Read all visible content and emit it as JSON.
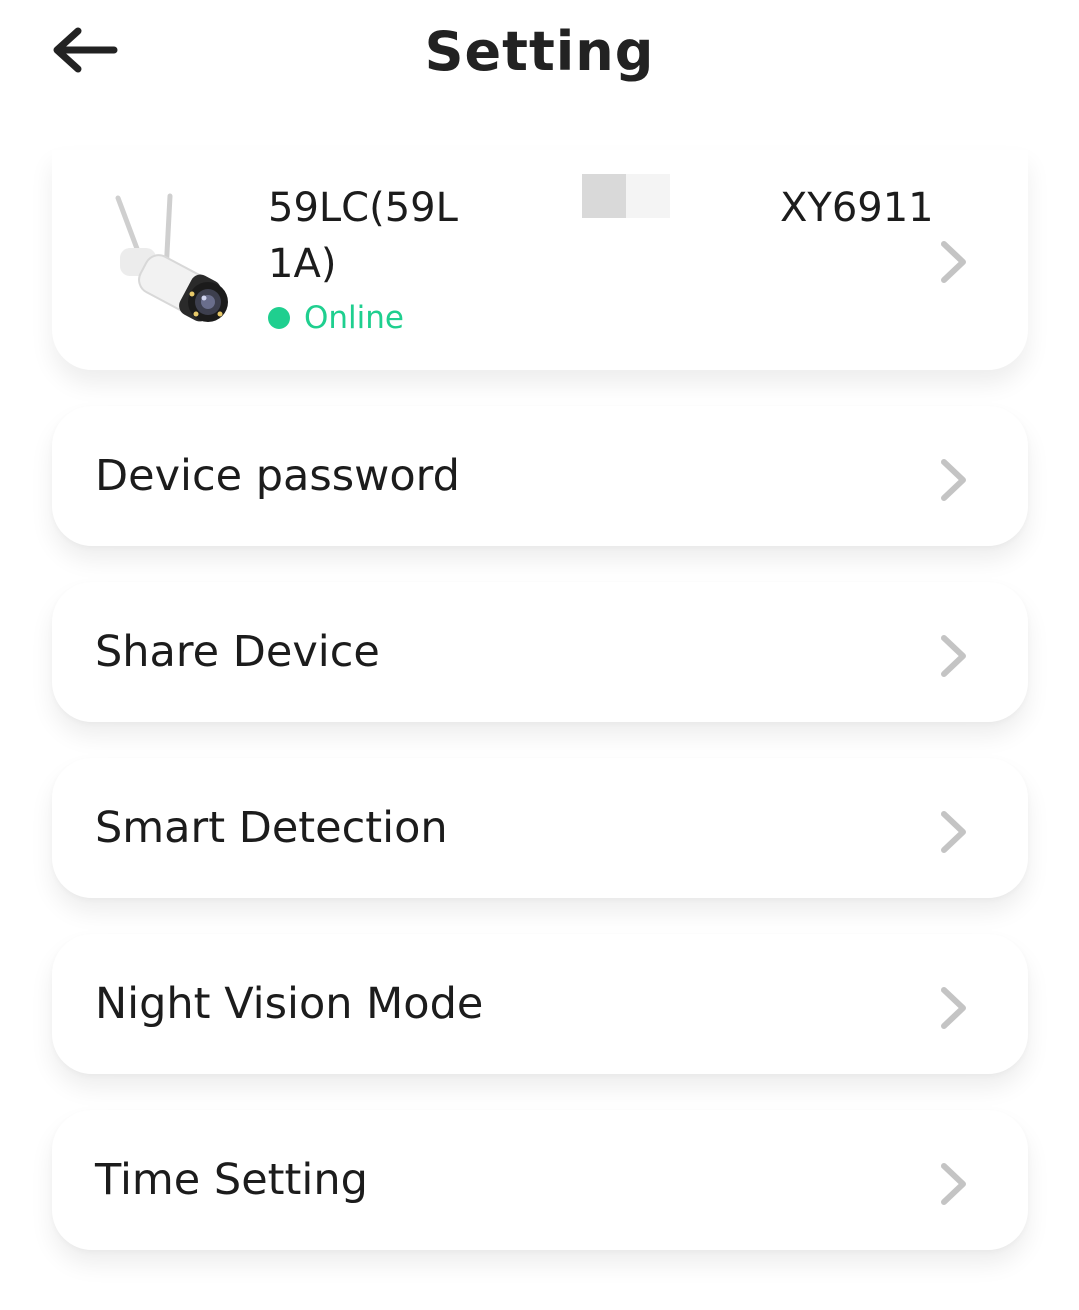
{
  "header": {
    "title": "Setting"
  },
  "device": {
    "name": "59LC(59L1A)",
    "serial_suffix": "XY6911",
    "status": "Online",
    "status_color": "#1fcf8f"
  },
  "menu": [
    {
      "label": "Device password"
    },
    {
      "label": "Share Device"
    },
    {
      "label": "Smart Detection"
    },
    {
      "label": "Night Vision Mode"
    },
    {
      "label": "Time Setting"
    }
  ],
  "icons": {
    "back": "arrow-left-icon",
    "chevron": "chevron-right-icon",
    "device": "outdoor-camera-icon"
  }
}
